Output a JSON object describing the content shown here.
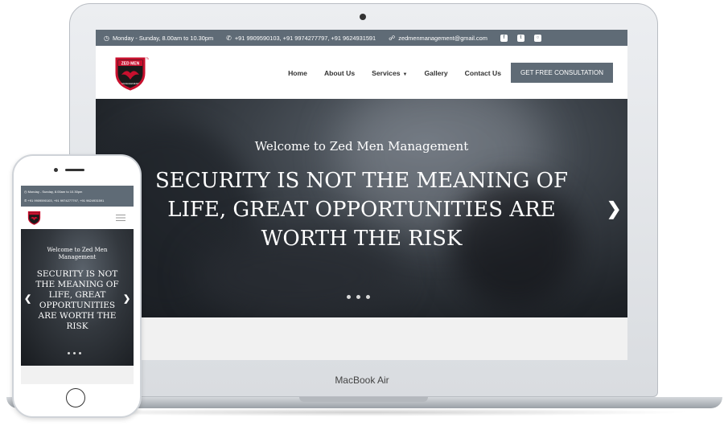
{
  "device_label": "MacBook Air",
  "topbar": {
    "hours": "Monday - Sunday, 8.00am to 10.30pm",
    "phones": "+91 9909590103, +91 9974277797, +91 9624931591",
    "email": "zedmenmanagement@gmail.com",
    "socials": [
      "facebook-icon",
      "twitter-icon",
      "instagram-icon"
    ]
  },
  "logo": {
    "text_top": "ZED MEN",
    "text_bottom": "MANAGEMENT",
    "tm": "TM"
  },
  "nav": {
    "items": [
      "Home",
      "About Us",
      "Services",
      "Gallery",
      "Contact Us"
    ],
    "cta": "GET FREE CONSULTATION"
  },
  "hero": {
    "welcome": "Welcome to Zed Men Management",
    "headline": "SECURITY IS NOT THE MEANING OF LIFE, GREAT OPPORTUNITIES ARE WORTH THE RISK",
    "slide_count": 3,
    "active_slide": 1
  },
  "mobile": {
    "hours": "Monday - Sunday, 8.00am to 10.30pm",
    "phones": "+91 9909590103, +91 9974277797, +91 9624931591",
    "welcome": "Welcome to Zed Men Management",
    "headline": "SECURITY IS NOT THE MEANING OF LIFE, GREAT OPPORTUNITIES ARE WORTH THE RISK"
  },
  "colors": {
    "topbar": "#5f6b76",
    "cta": "#5f6b76",
    "logo_red": "#c8102e",
    "logo_black": "#1a1a1a"
  }
}
